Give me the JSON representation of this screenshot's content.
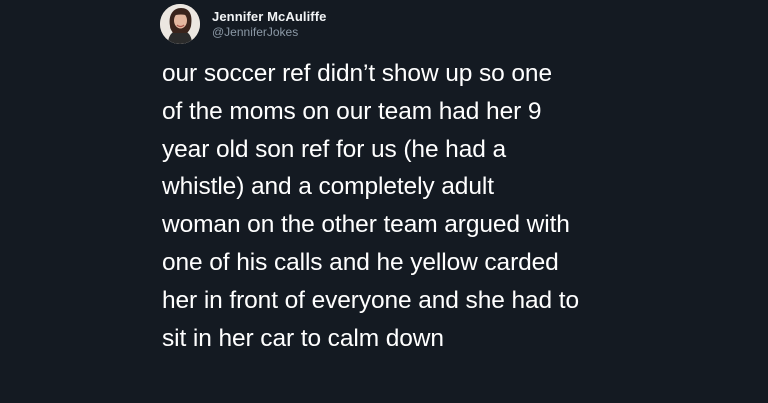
{
  "tweet": {
    "author": {
      "display_name": "Jennifer McAuliffe",
      "handle": "@JenniferJokes",
      "avatar": "profile-photo"
    },
    "text_lines": [
      "our soccer ref didn’t show up so one",
      "of the moms on our team had her 9",
      "year old son ref for us (he had a",
      "whistle) and a completely adult",
      "woman on the other team argued with",
      "one of his calls and he yellow carded",
      "her in front of everyone and she had to",
      "sit in her car to calm down"
    ]
  },
  "colors": {
    "background": "#141a22",
    "text": "#ffffff",
    "handle": "#8b98a5"
  }
}
